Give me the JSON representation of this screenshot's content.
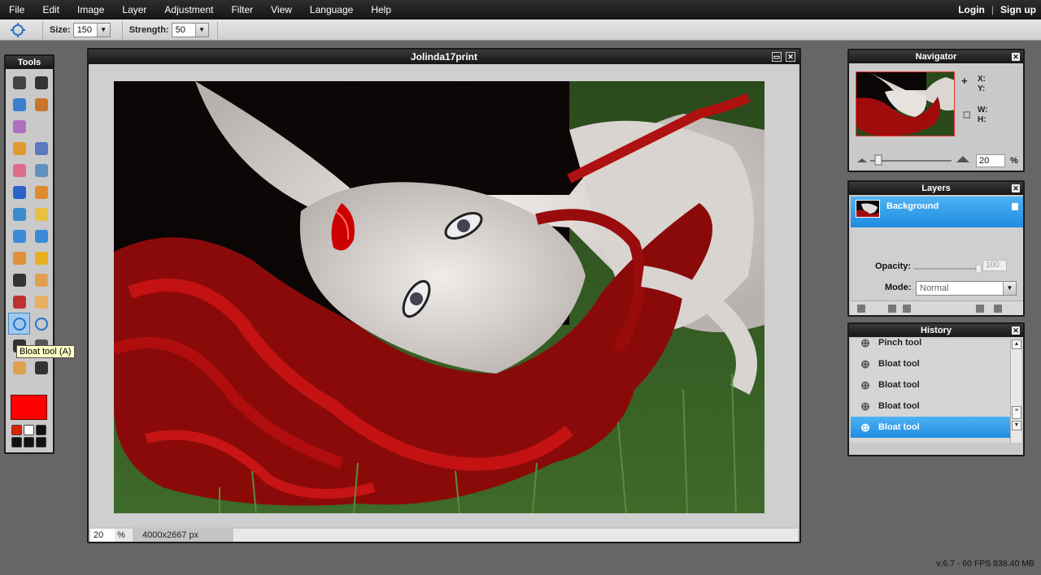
{
  "menubar": {
    "items": [
      "File",
      "Edit",
      "Image",
      "Layer",
      "Adjustment",
      "Filter",
      "View",
      "Language",
      "Help"
    ],
    "login": "Login",
    "separator": "|",
    "signup": "Sign up"
  },
  "options": {
    "tool_icon": "bloat-icon",
    "size_label": "Size:",
    "size_value": "150",
    "strength_label": "Strength:",
    "strength_value": "50"
  },
  "tools": {
    "title": "Tools",
    "tooltip": "Bloat tool (A)",
    "foreground_color": "#ff0000",
    "swatches": [
      "#dd2200",
      "#ffffff",
      "#111111",
      "#111111",
      "#111111",
      "#111111"
    ],
    "items": [
      {
        "name": "crop-icon",
        "color": "#444444"
      },
      {
        "name": "move-icon",
        "color": "#333333"
      },
      {
        "name": "marquee-icon",
        "color": "#3a7fd0"
      },
      {
        "name": "lasso-icon",
        "color": "#c8762a"
      },
      {
        "name": "magic-wand-icon",
        "color": "#b070c0"
      },
      {
        "name": "blank-icon",
        "color": "transparent"
      },
      {
        "name": "pencil-icon",
        "color": "#e09a30"
      },
      {
        "name": "brush-icon",
        "color": "#5a7ac0"
      },
      {
        "name": "eraser-icon",
        "color": "#e06a8a"
      },
      {
        "name": "fill-bucket-icon",
        "color": "#6090c0"
      },
      {
        "name": "gradient-icon",
        "color": "#2a62c8"
      },
      {
        "name": "clone-stamp-icon",
        "color": "#e08a30"
      },
      {
        "name": "color-replace-icon",
        "color": "#3a8ad0"
      },
      {
        "name": "draw-icon",
        "color": "#e8c040"
      },
      {
        "name": "blur-icon",
        "color": "#3a8ad8"
      },
      {
        "name": "sharpen-icon",
        "color": "#3a8ad8"
      },
      {
        "name": "smudge-icon",
        "color": "#e0903a"
      },
      {
        "name": "sponge-icon",
        "color": "#e8b020"
      },
      {
        "name": "dodge-icon",
        "color": "#333333"
      },
      {
        "name": "burn-icon",
        "color": "#e0a050"
      },
      {
        "name": "red-eye-icon",
        "color": "#c03030"
      },
      {
        "name": "spot-heal-icon",
        "color": "#e8b060"
      },
      {
        "name": "bloat-icon",
        "color": "#2a72c8"
      },
      {
        "name": "pinch-icon",
        "color": "#2a72c8"
      },
      {
        "name": "type-icon",
        "color": "#333333"
      },
      {
        "name": "eyedropper-icon",
        "color": "#555555"
      },
      {
        "name": "hand-icon",
        "color": "#e0a050"
      },
      {
        "name": "zoom-icon",
        "color": "#333333"
      }
    ]
  },
  "document": {
    "title": "Jolinda17print",
    "zoom": "20",
    "zoom_unit": "%",
    "dimensions": "4000x2667 px"
  },
  "navigator": {
    "title": "Navigator",
    "x_label": "X:",
    "y_label": "Y:",
    "w_label": "W:",
    "h_label": "H:",
    "zoom": "20",
    "zoom_unit": "%",
    "zoom_fraction": 0.1
  },
  "layers": {
    "title": "Layers",
    "layer_name": "Background",
    "opacity_label": "Opacity:",
    "opacity_value": "100",
    "mode_label": "Mode:",
    "mode_value": "Normal"
  },
  "history": {
    "title": "History",
    "items": [
      {
        "label": "Pinch tool",
        "active": false
      },
      {
        "label": "Bloat tool",
        "active": false
      },
      {
        "label": "Bloat tool",
        "active": false
      },
      {
        "label": "Bloat tool",
        "active": false
      },
      {
        "label": "Bloat tool",
        "active": true
      }
    ]
  },
  "status": {
    "version": "v:6.7 - 60 FPS 838.40 MB"
  }
}
